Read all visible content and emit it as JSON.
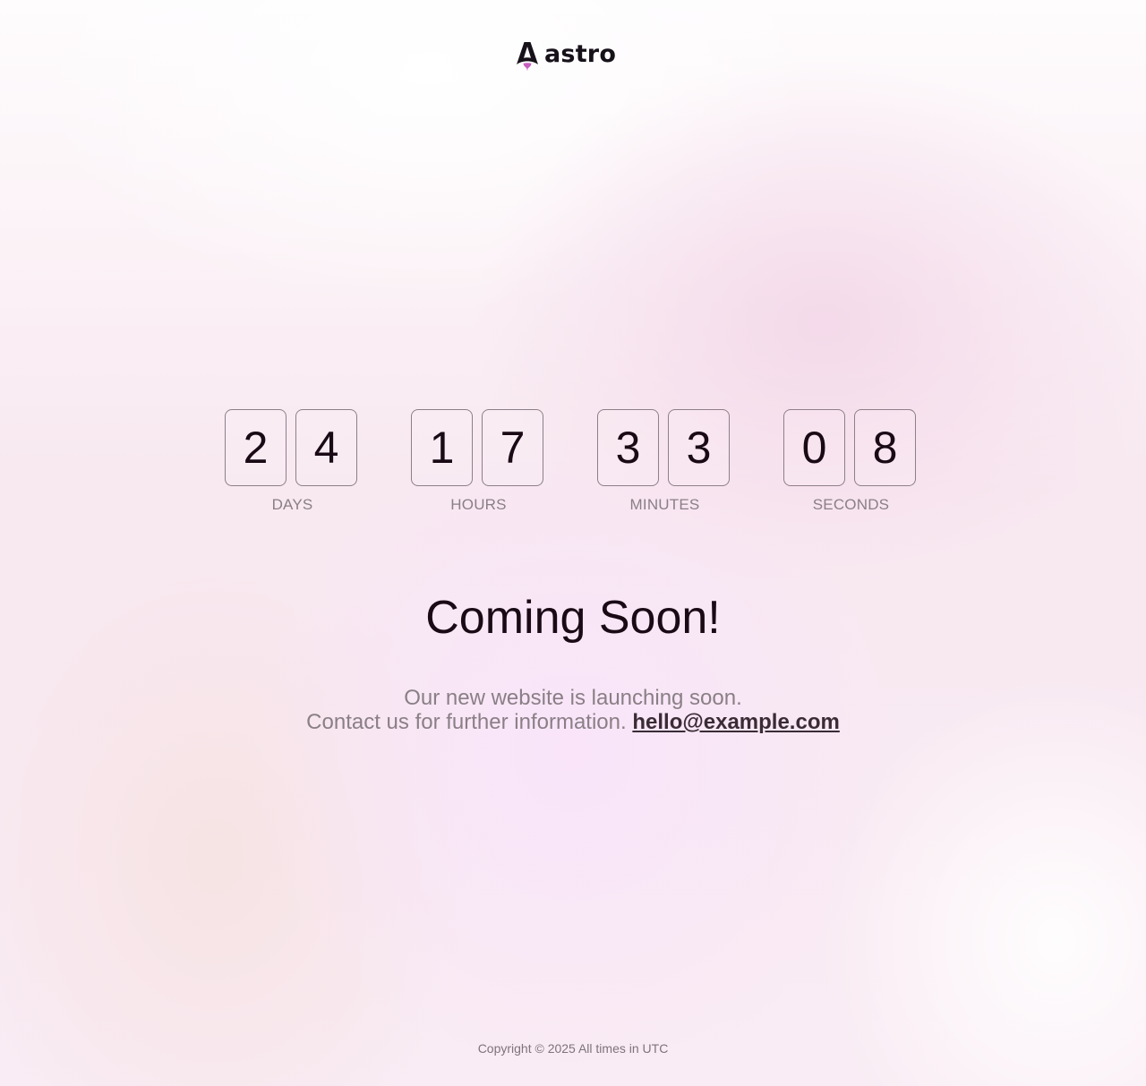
{
  "brand": {
    "name": "astro",
    "mark_color": "#17111a",
    "flame_color": "#c65fbf"
  },
  "countdown": [
    {
      "label": "DAYS",
      "digits": [
        "2",
        "4"
      ]
    },
    {
      "label": "HOURS",
      "digits": [
        "1",
        "7"
      ]
    },
    {
      "label": "MINUTES",
      "digits": [
        "3",
        "3"
      ]
    },
    {
      "label": "SECONDS",
      "digits": [
        "0",
        "8"
      ]
    }
  ],
  "hero": {
    "title": "Coming Soon!",
    "line1": "Our new website is launching soon.",
    "line2": "Contact us for further information.",
    "email": "hello@example.com"
  },
  "footer": {
    "text": "Copyright © 2025 All times in UTC"
  },
  "colors": {
    "text_dark": "#190a16",
    "text_muted": "#8a7f86",
    "digit_border": "#8d7f88"
  }
}
